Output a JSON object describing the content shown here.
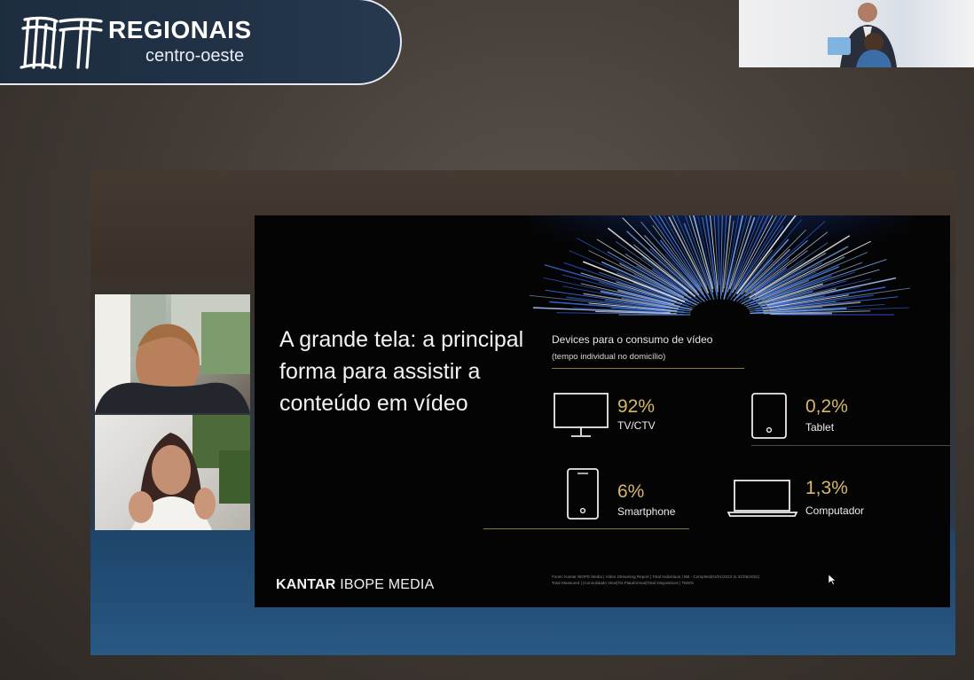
{
  "brand": {
    "title": "REGIONAIS",
    "subtitle": "centro-oeste"
  },
  "slide": {
    "headline": "A grande tela: a principal forma para assistir a conteúdo em vídeo",
    "devices_title": "Devices para o consumo de vídeo",
    "devices_subtitle": "(tempo individual no domicílio)",
    "devices": [
      {
        "name": "TV/CTV",
        "percent": "92%",
        "icon": "tv-icon"
      },
      {
        "name": "Tablet",
        "percent": "0,2%",
        "icon": "tablet-icon"
      },
      {
        "name": "Smartphone",
        "percent": "6%",
        "icon": "smartphone-icon"
      },
      {
        "name": "Computador",
        "percent": "1,3%",
        "icon": "laptop-icon"
      }
    ],
    "brand_left": "KANTAR",
    "brand_right": "IBOPE MEDIA",
    "source_line1": "Fonte: Kantar IBOPE Media | Video Streaming Report | Total Indivíduos | 8M - Completo|01/01/2022 to 31/05/2022|",
    "source_line2": "Total Measured | |Consolidado View|Tot.Plataformas|Total Dispositivos | TMS%"
  },
  "colors": {
    "accent_gold": "#d6b866",
    "banner_navy": "#213247"
  }
}
